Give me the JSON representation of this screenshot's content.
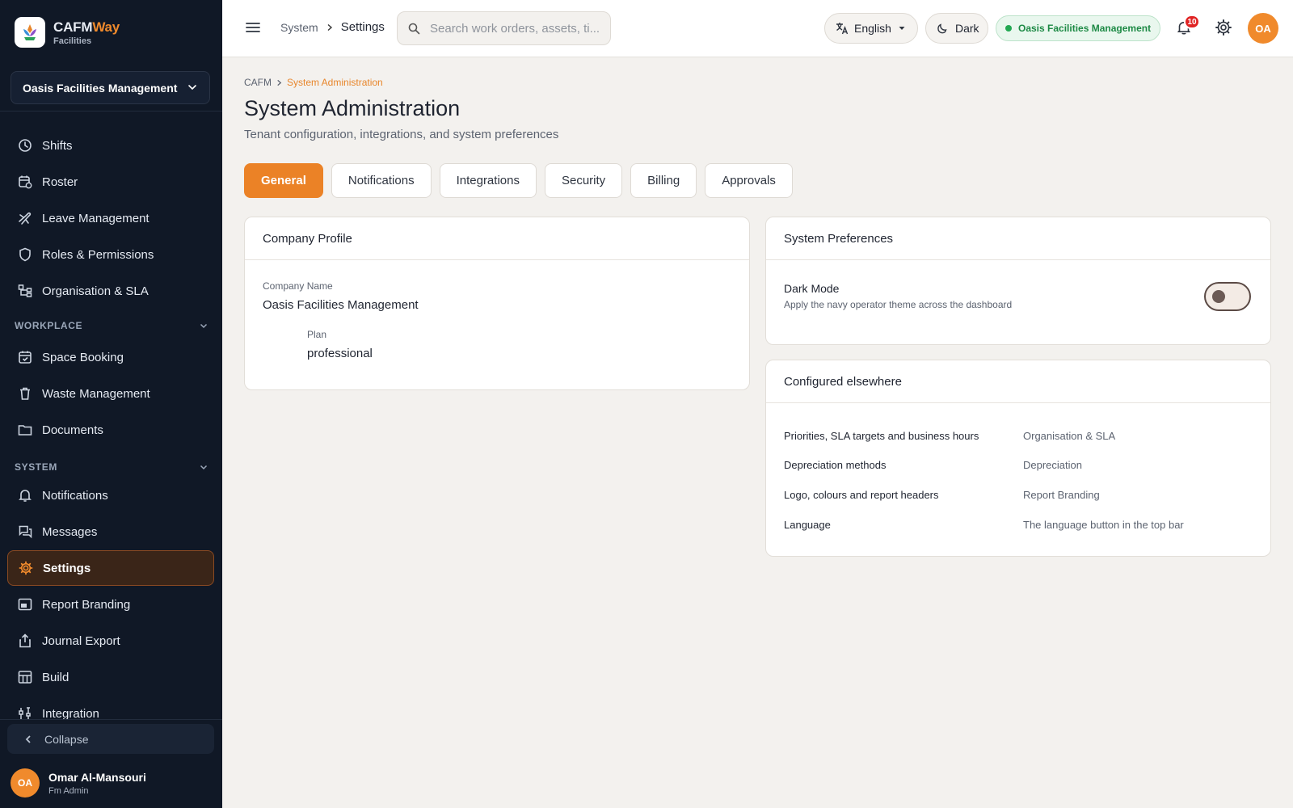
{
  "brand": {
    "name_primary": "CAFM",
    "name_accent": "Way",
    "subtitle": "Facilities"
  },
  "sidebar": {
    "org_selector": "Oasis Facilities Management",
    "items_top": [
      {
        "label": "Shifts",
        "icon": "clock-icon"
      },
      {
        "label": "Roster",
        "icon": "calendar-clock-icon"
      },
      {
        "label": "Leave Management",
        "icon": "plane-icon"
      },
      {
        "label": "Roles & Permissions",
        "icon": "shield-icon"
      },
      {
        "label": "Organisation & SLA",
        "icon": "hierarchy-icon"
      }
    ],
    "section_workplace": "WORKPLACE",
    "items_workplace": [
      {
        "label": "Space Booking",
        "icon": "calendar-check-icon"
      },
      {
        "label": "Waste Management",
        "icon": "trash-icon"
      },
      {
        "label": "Documents",
        "icon": "folder-icon"
      }
    ],
    "section_system": "SYSTEM",
    "items_system": [
      {
        "label": "Notifications",
        "icon": "bell-icon"
      },
      {
        "label": "Messages",
        "icon": "messages-icon"
      },
      {
        "label": "Settings",
        "icon": "gear-icon",
        "active": true
      },
      {
        "label": "Report Branding",
        "icon": "image-icon"
      },
      {
        "label": "Journal Export",
        "icon": "export-icon"
      },
      {
        "label": "Build",
        "icon": "grid-icon"
      },
      {
        "label": "Integration",
        "icon": "plug-icon"
      }
    ],
    "collapse_label": "Collapse",
    "user": {
      "initials": "OA",
      "name": "Omar Al-Mansouri",
      "role": "Fm Admin"
    }
  },
  "topbar": {
    "crumb_parent": "System",
    "crumb_current": "Settings",
    "search_placeholder": "Search work orders, assets, ti...",
    "language": "English",
    "theme_toggle": "Dark",
    "org_badge": "Oasis Facilities Management",
    "notification_count": "10",
    "avatar_initials": "OA"
  },
  "page": {
    "breadcrumb_root": "CAFM",
    "breadcrumb_current": "System Administration",
    "title": "System Administration",
    "subtitle": "Tenant configuration, integrations, and system preferences",
    "tabs": [
      "General",
      "Notifications",
      "Integrations",
      "Security",
      "Billing",
      "Approvals"
    ],
    "active_tab": "General"
  },
  "company_profile": {
    "title": "Company Profile",
    "company_name_label": "Company Name",
    "company_name": "Oasis Facilities Management",
    "plan_label": "Plan",
    "plan": "professional"
  },
  "system_preferences": {
    "title": "System Preferences",
    "dark_mode_label": "Dark Mode",
    "dark_mode_desc": "Apply the navy operator theme across the dashboard",
    "dark_mode_enabled": false
  },
  "configured_elsewhere": {
    "title": "Configured elsewhere",
    "rows": [
      {
        "setting": "Priorities, SLA targets and business hours",
        "location": "Organisation & SLA"
      },
      {
        "setting": "Depreciation methods",
        "location": "Depreciation"
      },
      {
        "setting": "Logo, colours and report headers",
        "location": "Report Branding"
      },
      {
        "setting": "Language",
        "location": "The language button in the top bar"
      }
    ]
  },
  "colors": {
    "accent": "#eb8226",
    "sidebar_bg": "#101826",
    "page_bg": "#f3f1ee",
    "status_green": "#22a852"
  }
}
